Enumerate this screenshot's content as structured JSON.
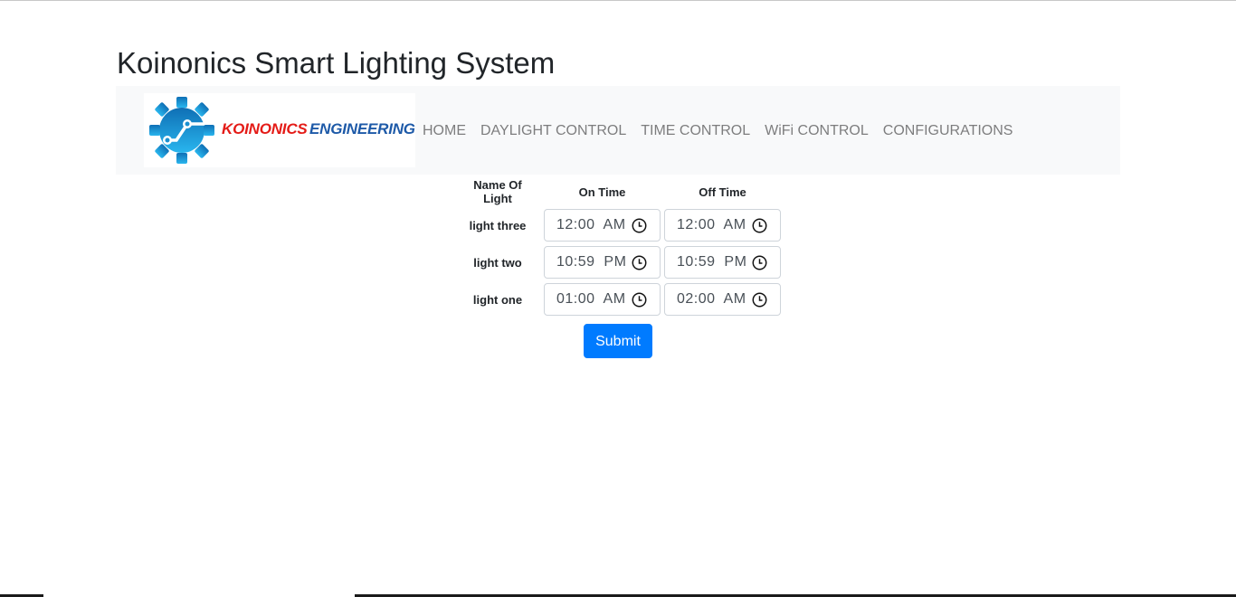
{
  "page": {
    "title": "Koinonics Smart Lighting System"
  },
  "brand": {
    "word_red": "KOINONICS",
    "word_blue": "ENGINEERING",
    "logo_icon": "gear-circuit-icon",
    "colors": {
      "red": "#e41b17",
      "blue": "#1e5aa8",
      "gear": "#1a90d0"
    }
  },
  "nav": {
    "items": [
      {
        "label": "HOME"
      },
      {
        "label": "DAYLIGHT CONTROL"
      },
      {
        "label": "TIME CONTROL"
      },
      {
        "label": "WiFi CONTROL"
      },
      {
        "label": "CONFIGURATIONS"
      }
    ]
  },
  "schedule": {
    "headers": {
      "name": "Name Of Light",
      "on": "On Time",
      "off": "Off Time"
    },
    "rows": [
      {
        "name": "light three",
        "on_time": "12:00  AM",
        "off_time": "12:00  AM"
      },
      {
        "name": "light two",
        "on_time": "10:59  PM",
        "off_time": "10:59  PM"
      },
      {
        "name": "light one",
        "on_time": "01:00  AM",
        "off_time": "02:00  AM"
      }
    ],
    "icon": "clock-icon"
  },
  "form": {
    "submit_label": "Submit",
    "accent_color": "#007bff"
  }
}
